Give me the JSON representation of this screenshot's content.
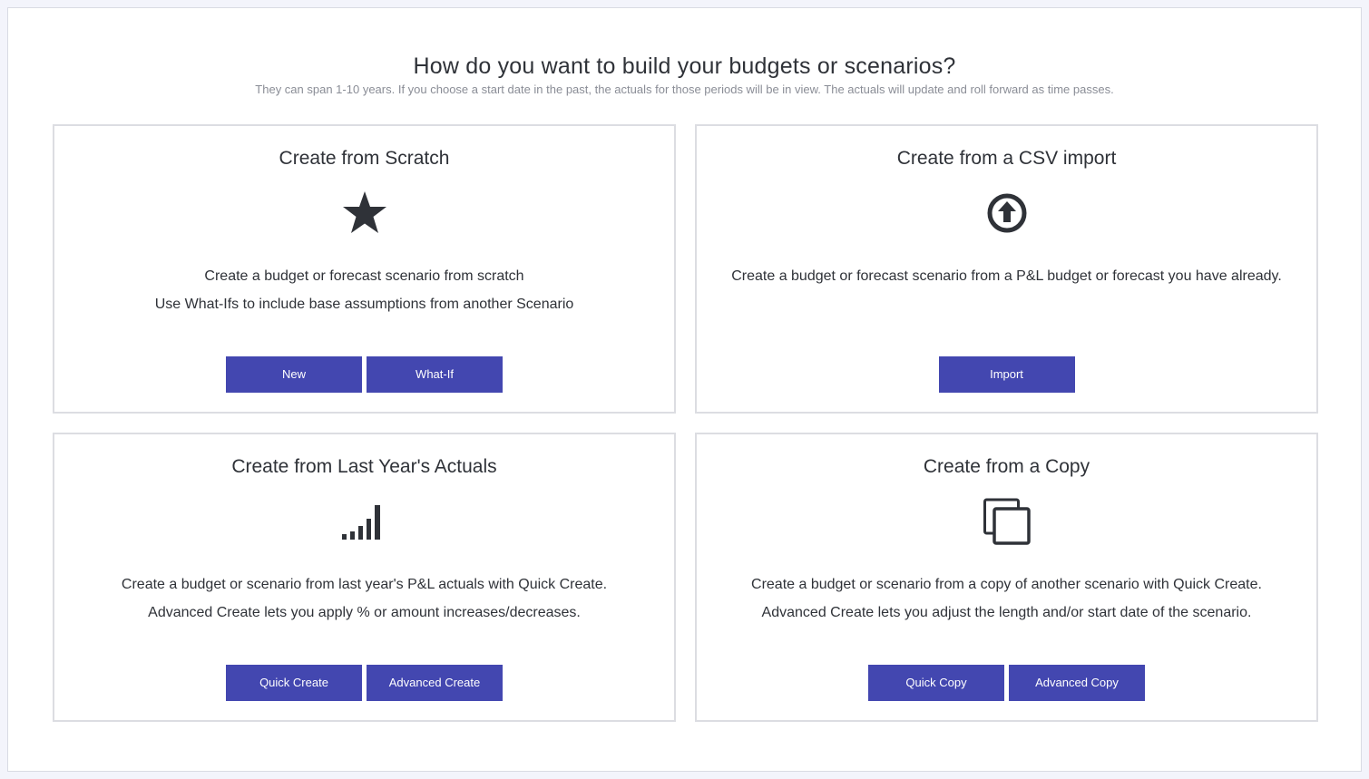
{
  "page": {
    "heading": "How do you want to build your budgets or scenarios?",
    "subheading": "They can span 1-10 years. If you choose a start date in the past, the actuals for those periods will be in view. The actuals will update and roll forward as time passes."
  },
  "colors": {
    "button": "#4347b0",
    "icon": "#2f3238",
    "border": "#dcdde2",
    "background": "#f3f4fb"
  },
  "cards": {
    "scratch": {
      "title": "Create from Scratch",
      "icon": "star-icon",
      "desc1": "Create a budget or forecast scenario from scratch",
      "desc2": "Use What-Ifs to include base assumptions from another Scenario",
      "buttons": [
        "New",
        "What-If"
      ]
    },
    "csv": {
      "title": "Create from a CSV import",
      "icon": "upload-arrow-circle-icon",
      "desc1": "Create a budget or forecast scenario from a P&L budget or forecast you have already.",
      "buttons": [
        "Import"
      ]
    },
    "actuals": {
      "title": "Create from Last Year's Actuals",
      "icon": "signal-bars-icon",
      "desc1": "Create a budget or scenario from last year's P&L actuals with Quick Create.",
      "desc2": "Advanced Create lets you apply % or amount increases/decreases.",
      "buttons": [
        "Quick Create",
        "Advanced Create"
      ]
    },
    "copy": {
      "title": "Create from a Copy",
      "icon": "copy-icon",
      "desc1": "Create a budget or scenario from a copy of another scenario with Quick Create.",
      "desc2": "Advanced Create lets you adjust the length and/or start date of the scenario.",
      "buttons": [
        "Quick Copy",
        "Advanced Copy"
      ]
    }
  }
}
